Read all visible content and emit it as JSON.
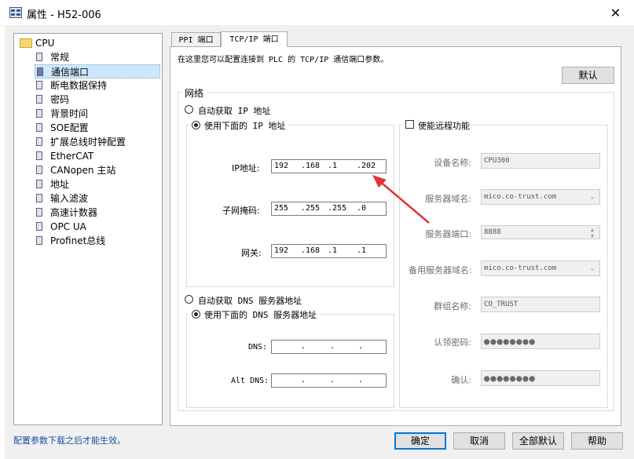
{
  "window": {
    "title": "属性 - H52-006",
    "close_glyph": "✕",
    "app_icon": "properties-app-icon"
  },
  "tree": {
    "root": "CPU",
    "items": [
      {
        "label": "常规"
      },
      {
        "label": "通信端口",
        "selected": true
      },
      {
        "label": "断电数据保持"
      },
      {
        "label": "密码"
      },
      {
        "label": "背景时间"
      },
      {
        "label": "SOE配置"
      },
      {
        "label": "扩展总线时钟配置"
      },
      {
        "label": "EtherCAT"
      },
      {
        "label": "CANopen 主站"
      },
      {
        "label": "地址"
      },
      {
        "label": "输入滤波"
      },
      {
        "label": "高速计数器"
      },
      {
        "label": "OPC UA"
      },
      {
        "label": "Profinet总线"
      }
    ]
  },
  "tabs": [
    {
      "label": "PPI 端口"
    },
    {
      "label": "TCP/IP 端口",
      "active": true
    }
  ],
  "panel": {
    "description": "在这里您可以配置连接到 PLC 的 TCP/IP 通信端口参数。",
    "default_button": "默认",
    "network_group": "网络",
    "auto_ip_label": "自动获取 IP 地址",
    "manual_ip_label": "使用下面的 IP 地址",
    "ip_label": "IP地址:",
    "ip": [
      "192",
      ".168",
      ".1",
      ".202"
    ],
    "subnet_label": "子网掩码:",
    "subnet": [
      "255",
      ".255",
      ".255",
      ".0"
    ],
    "gateway_label": "网关:",
    "gateway": [
      "192",
      ".168",
      ".1",
      ".1"
    ],
    "auto_dns_label": "自动获取 DNS 服务器地址",
    "manual_dns_label": "使用下面的 DNS 服务器地址",
    "dns_label": "DNS:",
    "dns": [
      "",
      ".",
      ".",
      "."
    ],
    "alt_dns_label": "Alt DNS:",
    "alt_dns": [
      "",
      ".",
      ".",
      "."
    ],
    "remote": {
      "enable_label": "使能远程功能",
      "device_name_label": "设备名称:",
      "device_name": "CPU300",
      "server_domain_label": "服务器域名:",
      "server_domain": "mico.co-trust.com",
      "server_port_label": "服务器端口:",
      "server_port": "8888",
      "backup_domain_label": "备用服务器域名:",
      "backup_domain": "mico.co-trust.com",
      "group_name_label": "群组名称:",
      "group_name": "CO_TRUST",
      "auth_password_label": "认领密码:",
      "auth_password": "●●●●●●●●",
      "confirm_label": "确认:",
      "confirm_password": "●●●●●●●●"
    }
  },
  "footer": {
    "status": "配置参数下载之后才能生效。",
    "ok": "确定",
    "cancel": "取消",
    "all_default": "全部默认",
    "help": "帮助"
  },
  "annotation": {
    "arrow_color": "#e0333a"
  }
}
